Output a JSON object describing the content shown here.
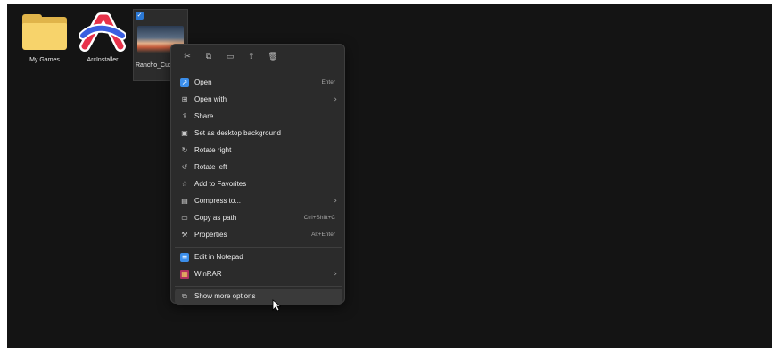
{
  "desktop": {
    "icons": [
      {
        "label": "My Games",
        "icon": "folder-icon"
      },
      {
        "label": "ArcInstaller",
        "icon": "arc-logo"
      },
      {
        "label": "Rancho_Cucamonga_NoTree",
        "display_label": "Rancho_Cuc nga_NoTre",
        "icon": "image-thumbnail",
        "selected": true
      }
    ]
  },
  "context_menu": {
    "toolbar": [
      {
        "icon": "cut-icon"
      },
      {
        "icon": "copy-icon"
      },
      {
        "icon": "rename-icon"
      },
      {
        "icon": "share-icon"
      },
      {
        "icon": "delete-icon"
      }
    ],
    "items": [
      {
        "label": "Open",
        "shortcut": "Enter",
        "icon": "open-icon",
        "icon_color": "#3b8eea"
      },
      {
        "label": "Open with",
        "submenu": true,
        "icon": "open-with-icon"
      },
      {
        "label": "Share",
        "icon": "share-icon"
      },
      {
        "label": "Set as desktop background",
        "icon": "desktop-background-icon"
      },
      {
        "label": "Rotate right",
        "icon": "rotate-right-icon"
      },
      {
        "label": "Rotate left",
        "icon": "rotate-left-icon"
      },
      {
        "label": "Add to Favorites",
        "icon": "star-icon"
      },
      {
        "label": "Compress to...",
        "submenu": true,
        "icon": "compress-icon"
      },
      {
        "label": "Copy as path",
        "shortcut": "Ctrl+Shift+C",
        "icon": "copy-path-icon"
      },
      {
        "label": "Properties",
        "shortcut": "Alt+Enter",
        "icon": "wrench-icon"
      },
      {
        "label": "Edit in Notepad",
        "icon": "notepad-icon",
        "icon_color": "#3b8eea"
      },
      {
        "label": "WinRAR",
        "submenu": true,
        "icon": "winrar-icon",
        "icon_color": "#b03060"
      },
      {
        "label": "Show more options",
        "icon": "more-options-icon",
        "hover": true
      }
    ]
  },
  "colors": {
    "desktop_bg": "#141414",
    "menu_bg": "#2b2b2b",
    "accent": "#2b78d4"
  }
}
